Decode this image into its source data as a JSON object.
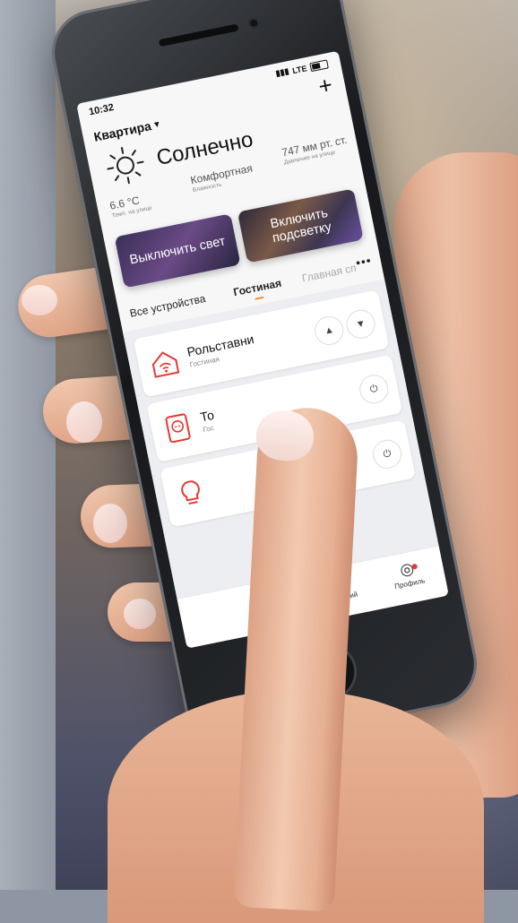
{
  "status": {
    "time": "10:32",
    "network": "LTE"
  },
  "header": {
    "apartment": "Квартира",
    "add_symbol": "+"
  },
  "weather": {
    "condition": "Солнечно",
    "temperature": "6.6 °C",
    "temperature_label": "Темп. на улице",
    "humidity": "Комфортная",
    "humidity_label": "Влажность",
    "pressure": "747 мм рт. ст.",
    "pressure_label": "Давление на улице"
  },
  "scenes": [
    {
      "label": "Выключить свет"
    },
    {
      "label": "Включить подсветку"
    }
  ],
  "tabs": [
    {
      "label": "Все устройства",
      "active": false
    },
    {
      "label": "Гостиная",
      "active": true
    },
    {
      "label": "Главная сп",
      "active": false
    }
  ],
  "more_symbol": "•••",
  "devices": [
    {
      "name": "Рольставни",
      "room": "Гостиная",
      "icon": "house-wifi-icon",
      "controls": [
        "arrow-up-icon",
        "arrow-down-icon"
      ]
    },
    {
      "name": "То",
      "room": "Гос",
      "icon": "socket-icon",
      "controls": [
        "power-icon"
      ]
    },
    {
      "name": "",
      "room": "",
      "icon": "bulb-icon",
      "controls": [
        "power-icon"
      ]
    }
  ],
  "bottom_nav": [
    {
      "label": "Сценарий",
      "icon": "sun-icon"
    },
    {
      "label": "Профиль",
      "icon": "profile-icon"
    }
  ],
  "colors": {
    "accent": "#f08c2a",
    "brand_red": "#d72128",
    "notification": "#e53935"
  }
}
